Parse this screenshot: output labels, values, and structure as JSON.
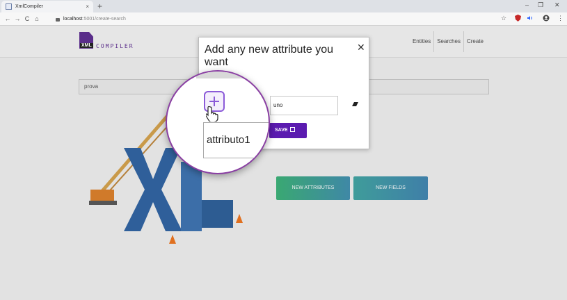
{
  "browser": {
    "tab_title": "XmlCompiler",
    "tab_close": "×",
    "new_tab": "+",
    "url_host": "localhost",
    "url_path": ":5001/create-search",
    "back": "←",
    "forward": "→",
    "reload": "C",
    "home": "⌂",
    "star": "☆",
    "menu": "⋮",
    "minimize": "–",
    "restore": "❐",
    "close": "✕"
  },
  "app": {
    "logo_xml": "XML",
    "logo_compiler": "COMPILER",
    "nav": [
      "Entities",
      "Searches",
      "Create"
    ]
  },
  "main": {
    "search_value": "prova",
    "new_attributes_button": "NEW ATTRIBUTES",
    "new_fields_button": "NEW FIELDS"
  },
  "modal": {
    "title": "Add any new attribute you want",
    "close": "✕",
    "value_input": "uno",
    "save_button": "SAVE"
  },
  "magnifier": {
    "attribute_name": "attributo1"
  },
  "colors": {
    "accent": "#5b1bb0",
    "magnifier_ring": "#8a3fa3",
    "button_green": "#3aa872",
    "button_blue": "#3f88a6"
  }
}
